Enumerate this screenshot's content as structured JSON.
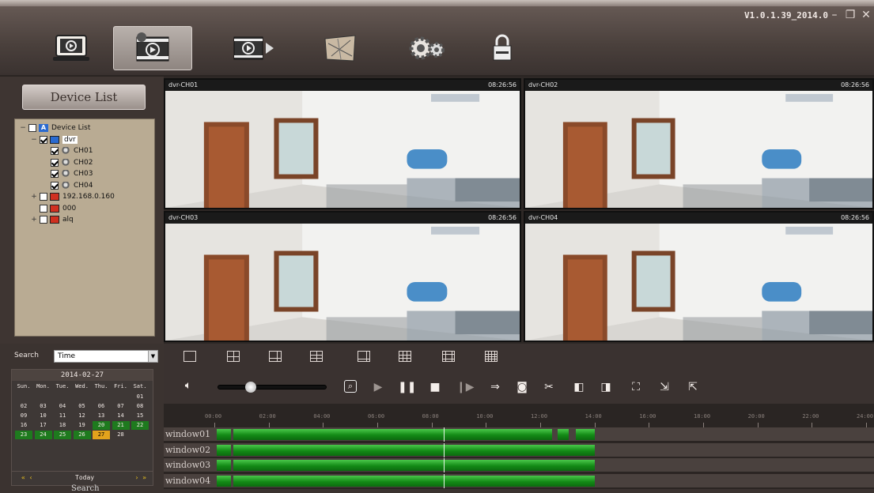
{
  "app": {
    "version": "V1.0.1.39_2014.0"
  },
  "nav": [
    {
      "name": "live-view"
    },
    {
      "name": "playback",
      "active": true
    },
    {
      "name": "export"
    },
    {
      "name": "map"
    },
    {
      "name": "settings"
    },
    {
      "name": "lock"
    }
  ],
  "sidebar": {
    "header": "Device List",
    "tree": [
      {
        "label": "Device List",
        "indent": 0,
        "checked": false,
        "pm": "−",
        "icon": "A"
      },
      {
        "label": "dvr",
        "indent": 1,
        "checked": true,
        "pm": "−",
        "icon": "monitor"
      },
      {
        "label": "CH01",
        "indent": 2,
        "checked": true,
        "icon": "camera"
      },
      {
        "label": "CH02",
        "indent": 2,
        "checked": true,
        "icon": "camera"
      },
      {
        "label": "CH03",
        "indent": 2,
        "checked": true,
        "icon": "camera"
      },
      {
        "label": "CH04",
        "indent": 2,
        "checked": true,
        "icon": "camera"
      },
      {
        "label": "192.168.0.160",
        "indent": 1,
        "checked": false,
        "pm": "+",
        "icon": "monitor-red"
      },
      {
        "label": "000",
        "indent": 1,
        "checked": false,
        "icon": "monitor-red"
      },
      {
        "label": "alq",
        "indent": 1,
        "checked": false,
        "pm": "+",
        "icon": "monitor-red"
      }
    ]
  },
  "videos": [
    {
      "label": "dvr-CH01",
      "time": "08:26:56"
    },
    {
      "label": "dvr-CH02",
      "time": "08:26:56"
    },
    {
      "label": "dvr-CH03",
      "time": "08:26:56"
    },
    {
      "label": "dvr-CH04",
      "time": "08:26:56"
    }
  ],
  "search": {
    "label": "Search",
    "type": "Time",
    "button": "Search",
    "calendar": {
      "title": "2014-02-27",
      "weekdays": [
        "Sun.",
        "Mon.",
        "Tue.",
        "Wed.",
        "Thu.",
        "Fri.",
        "Sat."
      ],
      "days": [
        "01",
        "02",
        "03",
        "04",
        "05",
        "06",
        "07",
        "08",
        "09",
        "10",
        "11",
        "12",
        "13",
        "14",
        "15",
        "16",
        "17",
        "18",
        "19",
        "20",
        "21",
        "22",
        "23",
        "24",
        "25",
        "26",
        "27",
        "28"
      ],
      "first_day_col": 6,
      "record_days": [
        "20",
        "21",
        "22",
        "23",
        "24",
        "25",
        "26"
      ],
      "today_day": "27",
      "prev": "«  ‹",
      "today": "Today",
      "next": "›  »"
    }
  },
  "timeline": {
    "ticks": [
      "00:00",
      "02:00",
      "04:00",
      "06:00",
      "08:00",
      "10:00",
      "12:00",
      "14:00",
      "16:00",
      "18:00",
      "20:00",
      "22:00",
      "24:00"
    ],
    "cursor_hour": 8.45,
    "tracks": [
      {
        "label": "window01",
        "segments": [
          [
            0.1,
            0.6
          ],
          [
            0.7,
            12.45
          ],
          [
            12.65,
            13.05
          ],
          [
            13.3,
            14.0
          ]
        ]
      },
      {
        "label": "window02",
        "segments": [
          [
            0.1,
            0.6
          ],
          [
            0.7,
            14.0
          ]
        ]
      },
      {
        "label": "window03",
        "segments": [
          [
            0.1,
            0.6
          ],
          [
            0.7,
            14.0
          ]
        ]
      },
      {
        "label": "window04",
        "segments": [
          [
            0.1,
            0.6
          ],
          [
            0.7,
            14.0
          ]
        ]
      }
    ]
  }
}
